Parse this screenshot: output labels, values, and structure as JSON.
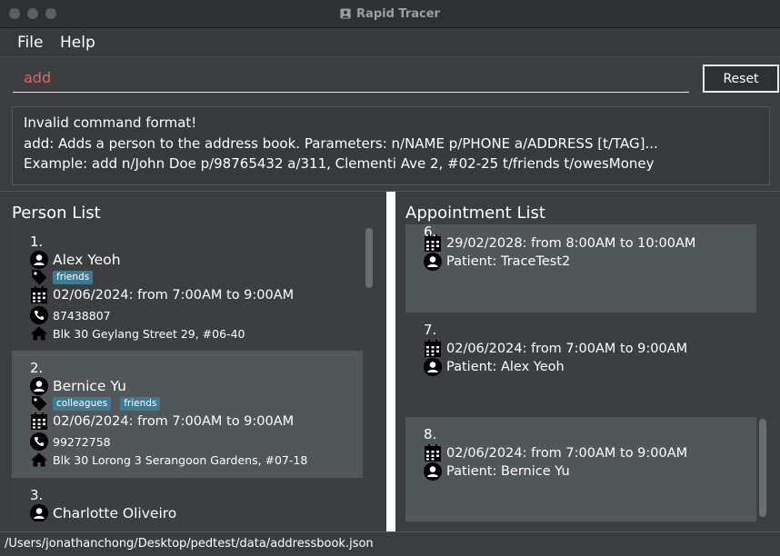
{
  "window": {
    "title": "Rapid Tracer"
  },
  "menu": {
    "file": "File",
    "help": "Help"
  },
  "command": {
    "value": "add",
    "reset_label": "Reset"
  },
  "result": {
    "lines": [
      "Invalid command format!",
      "add: Adds a person to the address book. Parameters: n/NAME p/PHONE a/ADDRESS [t/TAG]...",
      "Example: add n/John Doe p/98765432 a/311, Clementi Ave 2, #02-25 t/friends t/owesMoney"
    ]
  },
  "person_list": {
    "title": "Person List",
    "persons": [
      {
        "index": "1.",
        "name": "Alex Yeoh",
        "tags": [
          "friends"
        ],
        "appointment": "02/06/2024: from 7:00AM to 9:00AM",
        "phone": "87438807",
        "address": "Blk 30 Geylang Street 29, #06-40"
      },
      {
        "index": "2.",
        "name": "Bernice Yu",
        "tags": [
          "colleagues",
          "friends"
        ],
        "appointment": "02/06/2024: from 7:00AM to 9:00AM",
        "phone": "99272758",
        "address": "Blk 30 Lorong 3 Serangoon Gardens, #07-18"
      },
      {
        "index": "3.",
        "name": "Charlotte Oliveiro"
      }
    ]
  },
  "appointment_list": {
    "title": "Appointment List",
    "appointments": [
      {
        "index": "6.",
        "datetime": "29/02/2028: from 8:00AM to 10:00AM",
        "patient": "Patient: TraceTest2"
      },
      {
        "index": "7.",
        "datetime": "02/06/2024: from 7:00AM to 9:00AM",
        "patient": "Patient: Alex Yeoh"
      },
      {
        "index": "8.",
        "datetime": "02/06/2024: from 7:00AM to 9:00AM",
        "patient": "Patient: Bernice Yu"
      }
    ]
  },
  "status": {
    "path": "/Users/jonathanchong/Desktop/pedtest/data/addressbook.json"
  },
  "icons": {
    "person": "person-circle-icon",
    "tag": "tag-icon",
    "calendar": "calendar-icon",
    "phone": "phone-icon",
    "home": "home-icon"
  },
  "colors": {
    "command_text": "#e06660",
    "tag_bg": "#3e7b91",
    "card_light": "#515658",
    "card_dark": "#3c3e40"
  }
}
